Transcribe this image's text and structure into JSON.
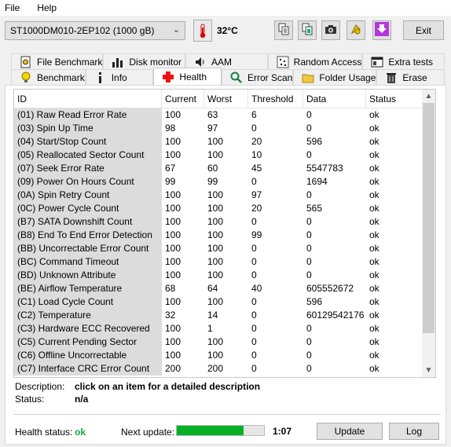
{
  "menu": {
    "file": "File",
    "help": "Help"
  },
  "toolbar": {
    "drive": "ST1000DM010-2EP102 (1000 gB)",
    "temperature": "32°C",
    "exit_label": "Exit",
    "icons": [
      "copy-text-icon",
      "copy-screenshot-icon",
      "camera-icon",
      "health-info-icon",
      "download-icon"
    ]
  },
  "tabs_top": [
    "File Benchmark",
    "Disk monitor",
    "AAM",
    "Random Access",
    "Extra tests"
  ],
  "tabs_bottom": [
    "Benchmark",
    "Info",
    "Health",
    "Error Scan",
    "Folder Usage",
    "Erase"
  ],
  "active_tab": "Health",
  "table": {
    "headers": [
      "ID",
      "Current",
      "Worst",
      "Threshold",
      "Data",
      "Status"
    ],
    "rows": [
      [
        "(01) Raw Read Error Rate",
        "100",
        "63",
        "6",
        "0",
        "ok"
      ],
      [
        "(03) Spin Up Time",
        "98",
        "97",
        "0",
        "0",
        "ok"
      ],
      [
        "(04) Start/Stop Count",
        "100",
        "100",
        "20",
        "596",
        "ok"
      ],
      [
        "(05) Reallocated Sector Count",
        "100",
        "100",
        "10",
        "0",
        "ok"
      ],
      [
        "(07) Seek Error Rate",
        "67",
        "60",
        "45",
        "5547783",
        "ok"
      ],
      [
        "(09) Power On Hours Count",
        "99",
        "99",
        "0",
        "1694",
        "ok"
      ],
      [
        "(0A) Spin Retry Count",
        "100",
        "100",
        "97",
        "0",
        "ok"
      ],
      [
        "(0C) Power Cycle Count",
        "100",
        "100",
        "20",
        "565",
        "ok"
      ],
      [
        "(B7) SATA Downshift Count",
        "100",
        "100",
        "0",
        "0",
        "ok"
      ],
      [
        "(B8) End To End Error Detection",
        "100",
        "100",
        "99",
        "0",
        "ok"
      ],
      [
        "(BB) Uncorrectable Error Count",
        "100",
        "100",
        "0",
        "0",
        "ok"
      ],
      [
        "(BC) Command Timeout",
        "100",
        "100",
        "0",
        "0",
        "ok"
      ],
      [
        "(BD) Unknown Attribute",
        "100",
        "100",
        "0",
        "0",
        "ok"
      ],
      [
        "(BE) Airflow Temperature",
        "68",
        "64",
        "40",
        "605552672",
        "ok"
      ],
      [
        "(C1) Load Cycle Count",
        "100",
        "100",
        "0",
        "596",
        "ok"
      ],
      [
        "(C2) Temperature",
        "32",
        "14",
        "0",
        "60129542176",
        "ok"
      ],
      [
        "(C3) Hardware ECC Recovered",
        "100",
        "1",
        "0",
        "0",
        "ok"
      ],
      [
        "(C5) Current Pending Sector",
        "100",
        "100",
        "0",
        "0",
        "ok"
      ],
      [
        "(C6) Offline Uncorrectable",
        "100",
        "100",
        "0",
        "0",
        "ok"
      ],
      [
        "(C7) Interface CRC Error Count",
        "200",
        "200",
        "0",
        "0",
        "ok"
      ]
    ]
  },
  "description": {
    "label": "Description:",
    "value": "click on an item for a detailed description",
    "status_label": "Status:",
    "status_value": "n/a"
  },
  "footer": {
    "health_label": "Health status:",
    "health_value": "ok",
    "next_update_label": "Next update:",
    "progress_fraction": 0.77,
    "timer": "1:07",
    "update_label": "Update",
    "log_label": "Log"
  },
  "colors": {
    "ok": "#1aa33a",
    "progress": "#06b025"
  }
}
